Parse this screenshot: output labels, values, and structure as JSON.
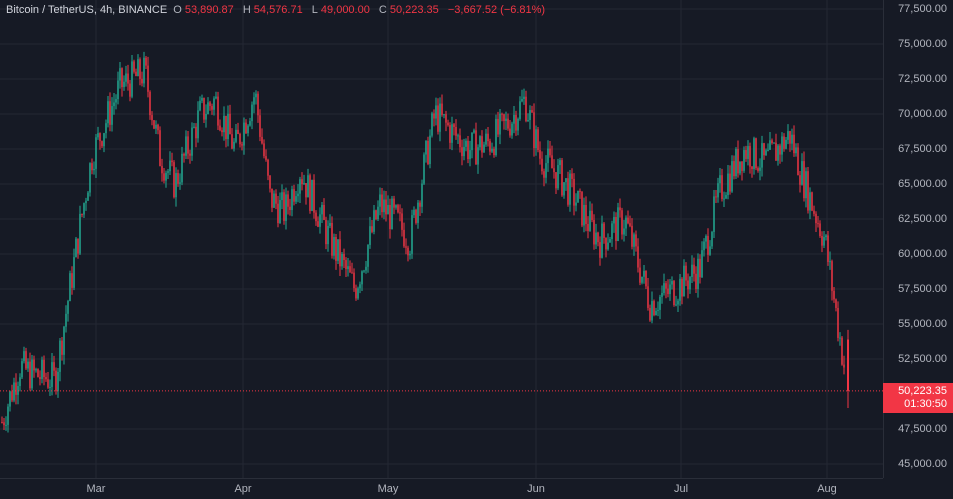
{
  "legend": {
    "symbol": "Bitcoin / TetherUS, 4h, BINANCE",
    "o_label": "O",
    "o_value": "53,890.87",
    "h_label": "H",
    "h_value": "54,576.71",
    "l_label": "L",
    "l_value": "49,000.00",
    "c_label": "C",
    "c_value": "50,223.35",
    "change": "−3,667.52 (−6.81%)"
  },
  "price_axis": {
    "labels": [
      "77,500.00",
      "75,000.00",
      "72,500.00",
      "70,000.00",
      "67,500.00",
      "65,000.00",
      "62,500.00",
      "60,000.00",
      "57,500.00",
      "55,000.00",
      "52,500.00",
      "47,500.00",
      "45,000.00"
    ]
  },
  "current_price": {
    "price": "50,223.35",
    "countdown": "01:30:50"
  },
  "time_axis": {
    "labels": [
      "Mar",
      "Apr",
      "May",
      "Jun",
      "Jul",
      "Aug"
    ]
  },
  "colors": {
    "up": "#22ab94",
    "down": "#f23645",
    "grid": "#242833",
    "background": "#161a25"
  },
  "chart_data": {
    "type": "candlestick",
    "ylim": [
      45000,
      77500
    ],
    "grid": true,
    "x": [
      "Feb 18",
      "Feb 22",
      "Feb 26",
      "Feb 28",
      "Mar 1",
      "Mar 5",
      "Mar 10",
      "Mar 14",
      "Mar 19",
      "Mar 23",
      "Mar 28",
      "Apr 1",
      "Apr 5",
      "Apr 9",
      "Apr 13",
      "Apr 17",
      "Apr 21",
      "Apr 25",
      "Apr 29",
      "May 1",
      "May 5",
      "May 9",
      "May 13",
      "May 17",
      "May 21",
      "May 25",
      "May 29",
      "Jun 1",
      "Jun 5",
      "Jun 9",
      "Jun 13",
      "Jun 17",
      "Jun 21",
      "Jun 25",
      "Jun 29",
      "Jul 1",
      "Jul 5",
      "Jul 9",
      "Jul 13",
      "Jul 17",
      "Jul 21",
      "Jul 25",
      "Jul 29",
      "Aug 1",
      "Aug 3",
      "Aug 5"
    ],
    "close": [
      48000,
      52000,
      51500,
      51000,
      62000,
      67000,
      72000,
      73000,
      67000,
      65000,
      70000,
      71000,
      67500,
      71500,
      64000,
      63000,
      66000,
      63500,
      61000,
      57500,
      63500,
      62500,
      61000,
      66500,
      70000,
      68500,
      67500,
      68000,
      69500,
      71000,
      67000,
      65500,
      64000,
      62000,
      61000,
      62500,
      56500,
      57500,
      59000,
      64500,
      67500,
      66500,
      68500,
      65000,
      61000,
      50223
    ]
  }
}
